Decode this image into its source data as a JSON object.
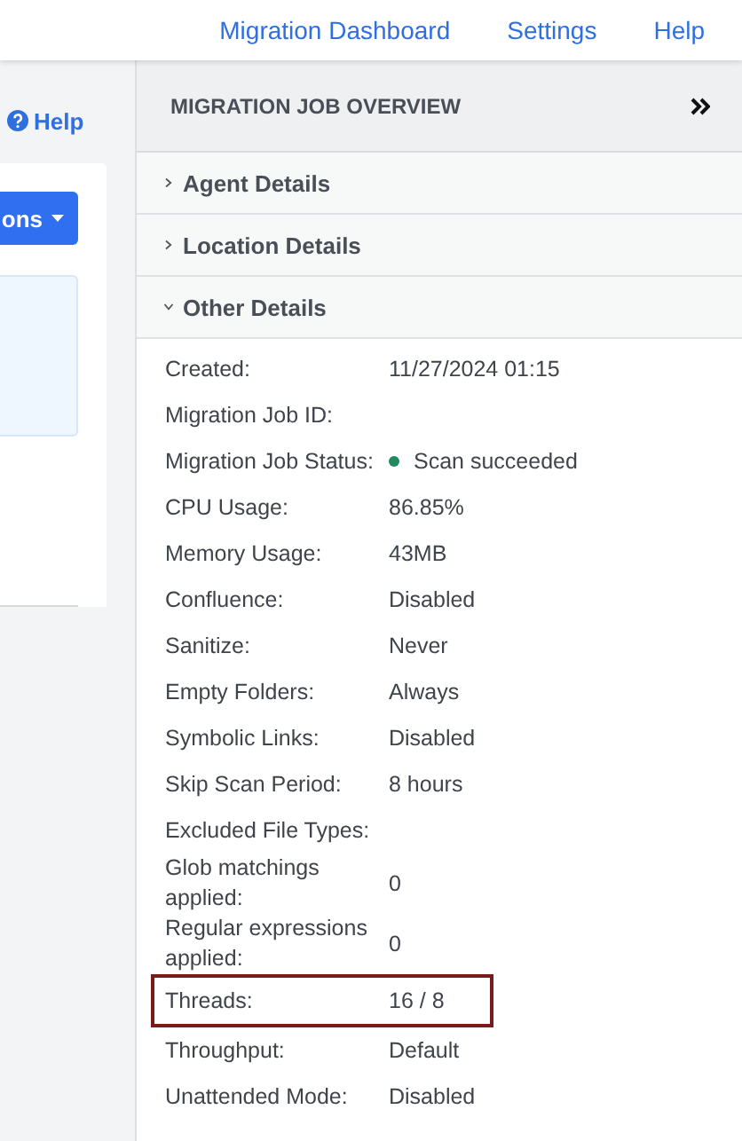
{
  "top_nav": [
    "Migration Dashboard",
    "Settings",
    "Help"
  ],
  "left": {
    "help_link": "Help",
    "actions_button": "ons"
  },
  "panel": {
    "title": "MIGRATION JOB OVERVIEW",
    "sections": [
      {
        "label": "Agent Details",
        "expanded": false
      },
      {
        "label": "Location Details",
        "expanded": false
      },
      {
        "label": "Other Details",
        "expanded": true
      }
    ],
    "details": [
      {
        "label": "Created:",
        "value": "11/27/2024 01:15",
        "highlighted": false
      },
      {
        "label": "Migration Job ID:",
        "highlighted": false
      },
      {
        "label": "Migration Job Status:",
        "value": "Scan succeeded",
        "color": "#1e8a5e",
        "highlighted": false
      },
      {
        "label": "CPU Usage:",
        "value": "86.85%",
        "highlighted": false
      },
      {
        "label": "Memory Usage:",
        "value": "43MB",
        "highlighted": false
      },
      {
        "label": "Confluence:",
        "value": "Disabled",
        "highlighted": false
      },
      {
        "label": "Sanitize:",
        "value": "Never",
        "highlighted": false
      },
      {
        "label": "Empty Folders:",
        "value": "Always",
        "highlighted": false
      },
      {
        "label": "Symbolic Links:",
        "value": "Disabled",
        "highlighted": false
      },
      {
        "label": "Skip Scan Period:",
        "value": "8 hours",
        "highlighted": false
      },
      {
        "label": "Excluded File Types:",
        "highlighted": false
      },
      {
        "label": "Glob matchings applied:",
        "value": "0",
        "highlighted": false
      },
      {
        "label": "Regular expressions applied:",
        "value": "0",
        "highlighted": false
      },
      {
        "label": "Threads:",
        "value": "16 / 8",
        "highlighted": true
      },
      {
        "label": "Throughput:",
        "value": "Default",
        "highlighted": false
      },
      {
        "label": "Unattended Mode:",
        "value": "Disabled",
        "highlighted": false
      }
    ]
  }
}
